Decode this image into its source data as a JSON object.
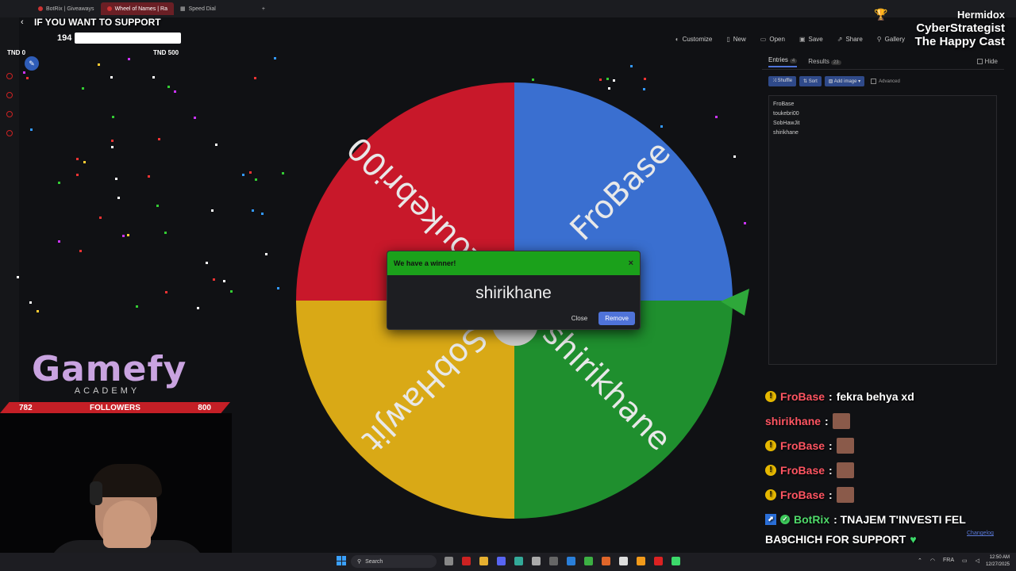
{
  "browser": {
    "tabs": [
      {
        "label": "BotRix | Giveaways",
        "active": false
      },
      {
        "label": "Wheel of Names | Ra",
        "active": true
      },
      {
        "label": "Speed Dial",
        "active": false
      }
    ],
    "new_tab": "+"
  },
  "toolbar": {
    "customize": "Customize",
    "new": "New",
    "open": "Open",
    "save": "Save",
    "share": "Share",
    "gallery": "Gallery"
  },
  "overlay": {
    "support_title": "IF YOU WANT TO SUPPORT",
    "goal_count": "194",
    "goal_min": "TND 0",
    "goal_max": "TND 500",
    "goal_fraction": 0.388,
    "streamer": "Hermidox",
    "line2": "CyberStrategist",
    "line3": "The Happy Cast"
  },
  "wheel": {
    "segments": [
      {
        "label": "toukebri00",
        "color": "#c8182a"
      },
      {
        "label": "FroBase",
        "color": "#3a6fd0"
      },
      {
        "label": "shirikhane",
        "color": "#1f8f2e"
      },
      {
        "label": "SobHawJit",
        "color": "#d9a916"
      }
    ],
    "pointer_color": "#2ea83a"
  },
  "dialog": {
    "header": "We have a winner!",
    "close_x": "×",
    "winner": "shirikhane",
    "close_label": "Close",
    "remove_label": "Remove",
    "header_color": "#1ba11b"
  },
  "panel": {
    "tab_entries": "Entries",
    "entries_count": "4",
    "tab_results": "Results",
    "results_count": "23",
    "hide_label": "Hide",
    "shuffle": "Shuffle",
    "sort": "Sort",
    "add_image": "Add image",
    "advanced": "Advanced",
    "entries": [
      "FroBase",
      "toukebri00",
      "SobHawJit",
      "shirikhane"
    ]
  },
  "chat": {
    "messages": [
      {
        "user": "FroBase",
        "text": "fekra behya xd",
        "badge": true,
        "emote": false
      },
      {
        "user": "shirikhane",
        "text": "",
        "badge": false,
        "emote": true
      },
      {
        "user": "FroBase",
        "text": "",
        "badge": true,
        "emote": true
      },
      {
        "user": "FroBase",
        "text": "",
        "badge": true,
        "emote": true
      },
      {
        "user": "FroBase",
        "text": "",
        "badge": true,
        "emote": true
      }
    ],
    "bot_user": "BotRix",
    "bot_text_1": ": TNAJEM T'INVESTI FEL",
    "bot_text_2": "BA9CHICH FOR SUPPORT",
    "changelog": "Changelog"
  },
  "branding": {
    "logo_big": "Gamefy",
    "logo_small": "ACADEMY",
    "followers_current": "782",
    "followers_label": "FOLLOWERS",
    "followers_goal": "800"
  },
  "taskbar": {
    "search": "Search",
    "lang": "FRA",
    "time": "12:50 AM",
    "date": "12/27/2025"
  }
}
